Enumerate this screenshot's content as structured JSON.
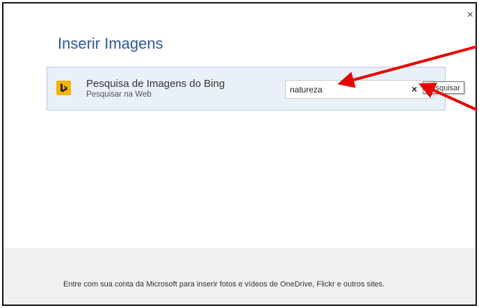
{
  "dialog": {
    "title": "Inserir Imagens",
    "close_label": "×"
  },
  "provider": {
    "name": "Pesquisa de Imagens do Bing",
    "subtitle": "Pesquisar na Web",
    "logo_icon": "bing-logo-icon",
    "logo_color": "#f5b400"
  },
  "search": {
    "value": "natureza",
    "clear_label": "×",
    "search_icon": "search-icon",
    "tooltip": "Pesquisar"
  },
  "footer": {
    "text": "Entre com sua conta da Microsoft para inserir fotos e vídeos de OneDrive, Flickr e outros sites."
  },
  "annotation": {
    "arrow_color": "#e60000"
  }
}
